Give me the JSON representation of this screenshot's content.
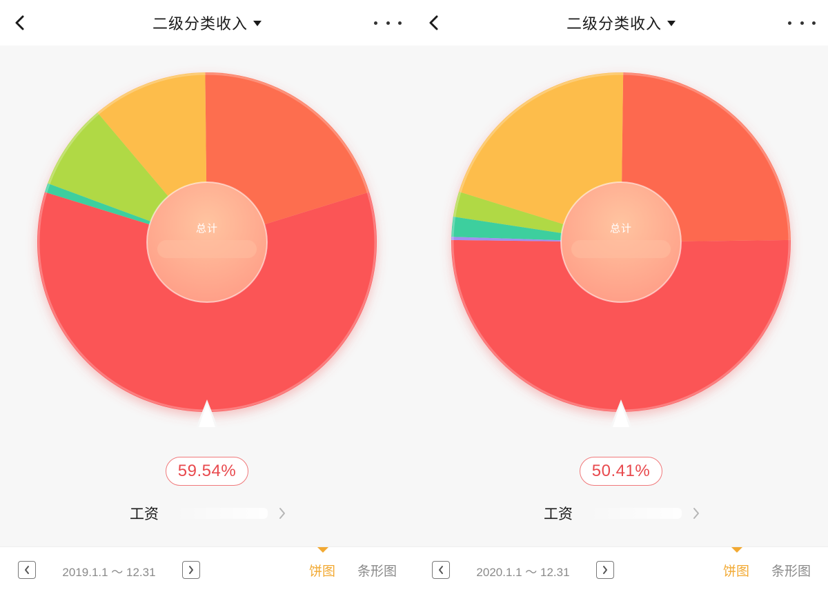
{
  "screens": [
    {
      "header": {
        "title": "二级分类收入"
      },
      "center_label": "总计",
      "selected_percent": "59.54%",
      "selected_category": "工资",
      "date_range": "2019.1.1 ～ 12.31",
      "tabs": {
        "pie": "饼图",
        "bar": "条形图"
      },
      "chart_data": {
        "type": "pie",
        "categories": [
          "工资",
          "",
          "",
          "",
          ""
        ],
        "values": [
          59.54,
          20.4,
          11.0,
          8.2,
          0.86
        ],
        "colors": [
          "#fb5457",
          "#fd6e4f",
          "#fdbd4c",
          "#b0d944",
          "#3ecf9e"
        ]
      }
    },
    {
      "header": {
        "title": "二级分类收入"
      },
      "center_label": "总计",
      "selected_percent": "50.41%",
      "selected_category": "工资",
      "date_range": "2020.1.1 ～ 12.31",
      "tabs": {
        "pie": "饼图",
        "bar": "条形图"
      },
      "chart_data": {
        "type": "pie",
        "categories": [
          "工资",
          "",
          "",
          "",
          "",
          ""
        ],
        "values": [
          50.41,
          24.59,
          20.4,
          2.4,
          1.9,
          0.3
        ],
        "colors": [
          "#fb5457",
          "#fd6950",
          "#fdbd4c",
          "#b0d944",
          "#3ecf9e",
          "#a48ef0"
        ]
      }
    }
  ]
}
